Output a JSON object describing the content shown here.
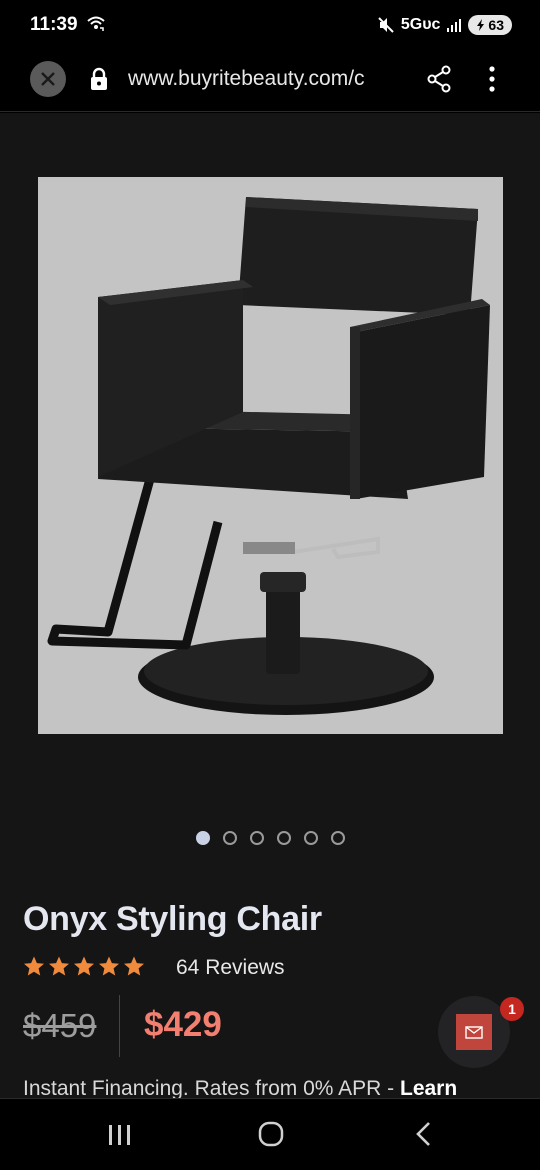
{
  "status_bar": {
    "time": "11:39",
    "network": "5Gᴜᴄ",
    "battery": "63",
    "icons": [
      "wifi-call-icon",
      "mute-icon",
      "signal-icon"
    ]
  },
  "browser": {
    "url": "www.buyritebeauty.com/c",
    "icons": [
      "close-icon",
      "lock-icon",
      "share-icon",
      "more-vert-icon"
    ]
  },
  "product": {
    "image_alt_icon": "styling-chair-image",
    "carousel_count": 6,
    "carousel_active": 0,
    "title": "Onyx Styling Chair",
    "rating": 5,
    "reviews": "64 Reviews",
    "old_price": "$459",
    "new_price": "$429",
    "financing_text": "Instant Financing. Rates from 0% APR - ",
    "financing_link": "Learn"
  },
  "chat": {
    "badge": "1",
    "icon": "mail-icon"
  },
  "colors": {
    "price": "#f27f6f",
    "stars": "#f08a3c",
    "background": "#151516",
    "badge": "#c3271f"
  },
  "nav": {
    "icons": [
      "recents-icon",
      "home-icon",
      "back-icon"
    ]
  }
}
